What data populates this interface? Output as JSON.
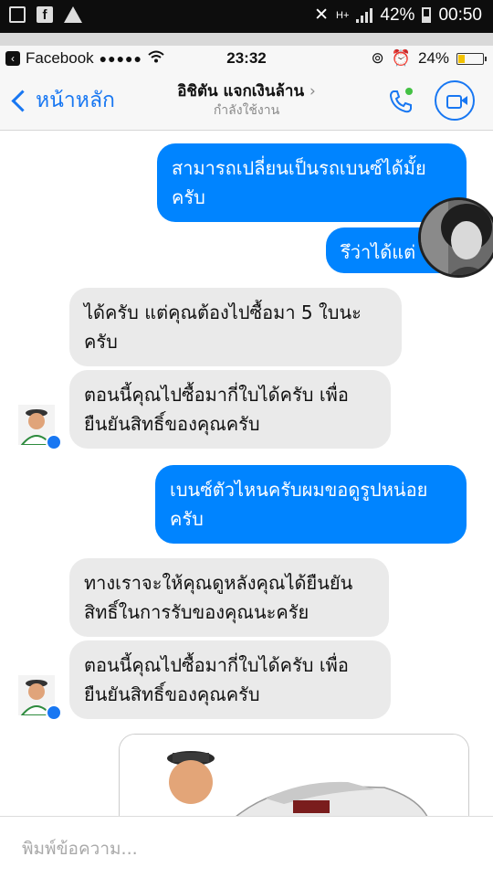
{
  "android_status": {
    "battery_percent": "42%",
    "time": "00:50",
    "network": "H+"
  },
  "ios_status": {
    "app_back": "Facebook",
    "signal_dots": "●●●●●",
    "time": "23:32",
    "battery_percent": "24%"
  },
  "header": {
    "back_label": "หน้าหลัก",
    "contact_name": "อิชิตัน แจกเงินล้าน",
    "status": "กำลังใช้งาน"
  },
  "messages": [
    {
      "from": "me",
      "text": "สามารถเปลี่ยนเป็นรถเบนซ์ได้มั้ยครับ"
    },
    {
      "from": "me",
      "text": "รึว่าได้แต่"
    },
    {
      "from": "them",
      "text": "ได้ครับ แต่คุณต้องไปซื้อมา 5 ใบนะครับ"
    },
    {
      "from": "them",
      "text": "ตอนนี้คุณไปซื้อมากี่ใบได้ครับ เพื่อยืนยันสิทธิ์ของคุณครับ"
    },
    {
      "from": "me",
      "text": "เบนซ์ตัวไหนครับผมขอดูรูปหน่อยครับ"
    },
    {
      "from": "them",
      "text": "ทางเราจะให้คุณดูหลังคุณได้ยืนยันสิทธิ์ในการรับของคุณนะครัย"
    },
    {
      "from": "them",
      "text": "ตอนนี้คุณไปซื้อมากี่ใบได้ครับ เพื่อยืนยันสิทธิ์ของคุณครับ"
    }
  ],
  "composer": {
    "placeholder": "พิมพ์ข้อความ..."
  },
  "colors": {
    "accent": "#1877f2",
    "outgoing_bubble": "#0084ff",
    "incoming_bubble": "#eaeaea",
    "online": "#44c144"
  }
}
